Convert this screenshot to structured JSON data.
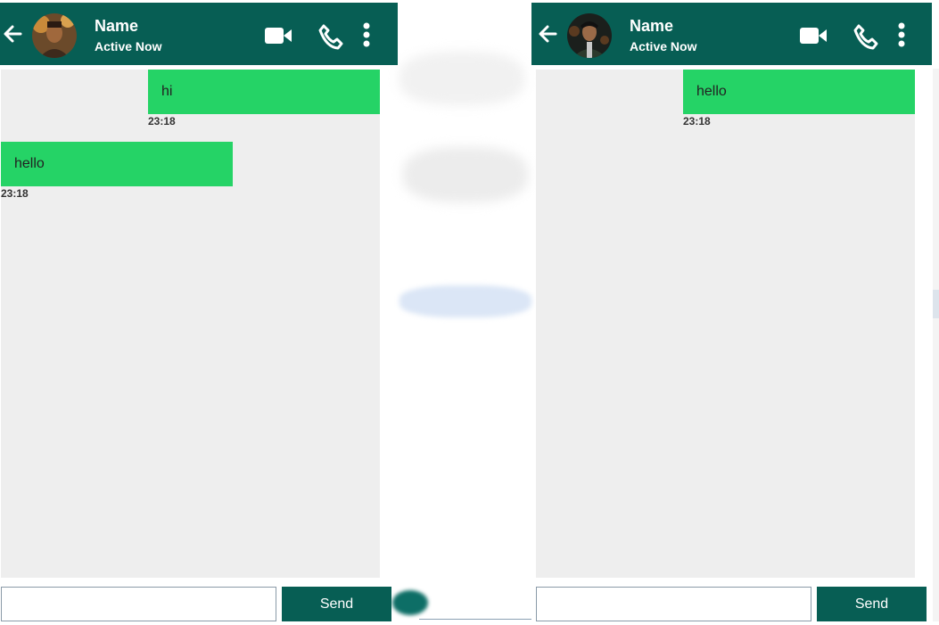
{
  "left_chat": {
    "header": {
      "name": "Name",
      "status": "Active Now"
    },
    "messages": [
      {
        "text": "hi",
        "time": "23:18",
        "side": "sent"
      },
      {
        "text": "hello",
        "time": "23:18",
        "side": "received"
      }
    ],
    "composer": {
      "value": "",
      "placeholder": "",
      "send_label": "Send"
    }
  },
  "right_chat": {
    "header": {
      "name": "Name",
      "status": "Active Now"
    },
    "messages": [
      {
        "text": "hello",
        "time": "23:18",
        "side": "sent"
      }
    ],
    "composer": {
      "value": "",
      "placeholder": "",
      "send_label": "Send"
    }
  },
  "colors": {
    "header_bg": "#075e54",
    "bubble_bg": "#25d366",
    "chat_bg": "#eeeeee",
    "send_bg": "#075e54"
  },
  "icons": [
    "back-arrow-icon",
    "video-call-icon",
    "phone-icon",
    "more-vert-icon"
  ]
}
